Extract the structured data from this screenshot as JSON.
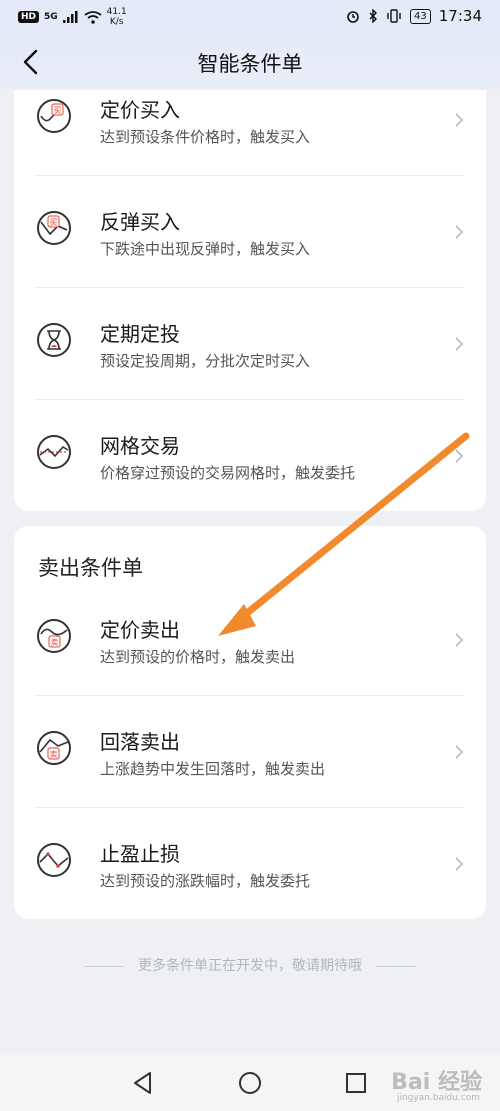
{
  "status_bar": {
    "hd": "HD",
    "signal": "5G",
    "speed_value": "41.1",
    "speed_unit": "K/s",
    "battery": "43",
    "time": "17:34"
  },
  "header": {
    "title": "智能条件单"
  },
  "buy_items": [
    {
      "label": "定价买入",
      "desc": "达到预设条件价格时，触发买入",
      "icon": "price-buy-icon"
    },
    {
      "label": "反弹买入",
      "desc": "下跌途中出现反弹时，触发买入",
      "icon": "rebound-buy-icon"
    },
    {
      "label": "定期定投",
      "desc": "预设定投周期，分批次定时买入",
      "icon": "hourglass-icon"
    },
    {
      "label": "网格交易",
      "desc": "价格穿过预设的交易网格时，触发委托",
      "icon": "grid-trade-icon"
    }
  ],
  "sell_section": {
    "title": "卖出条件单",
    "items": [
      {
        "label": "定价卖出",
        "desc": "达到预设的价格时，触发卖出",
        "icon": "price-sell-icon"
      },
      {
        "label": "回落卖出",
        "desc": "上涨趋势中发生回落时，触发卖出",
        "icon": "pullback-sell-icon"
      },
      {
        "label": "止盈止损",
        "desc": "达到预设的涨跌幅时，触发委托",
        "icon": "stop-loss-icon"
      }
    ]
  },
  "footer_note": "更多条件单正在开发中，敬请期待哦",
  "icon_glyphs": {
    "buy": "买",
    "sell": "卖"
  },
  "watermark": {
    "text": "Bai 经验",
    "sub": "jingyan.baidu.com"
  },
  "colors": {
    "accent_red": "#e0453a",
    "arrow": "#f08a2c",
    "header_bg": "#e4eaf7"
  }
}
